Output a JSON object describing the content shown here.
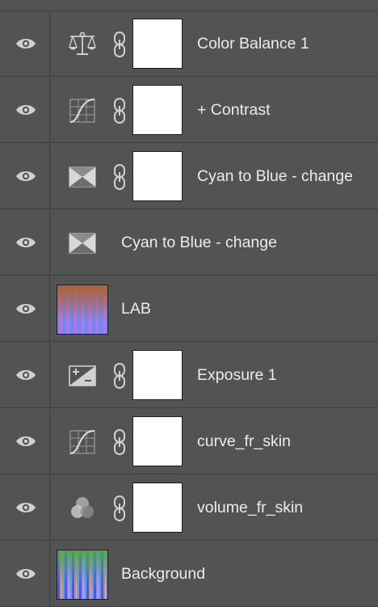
{
  "layers_panel": {
    "layers": [
      {
        "name": "Color Balance 1",
        "kind": "adjustment",
        "icon": "color-balance-icon",
        "has_mask": true,
        "visible": true
      },
      {
        "name": "+ Contrast",
        "kind": "adjustment",
        "icon": "curves-icon",
        "has_mask": true,
        "visible": true
      },
      {
        "name": "Cyan to Blue - change",
        "kind": "adjustment",
        "icon": "channel-mixer-icon",
        "has_mask": true,
        "visible": true
      },
      {
        "name": "Cyan to Blue - change",
        "kind": "adjustment",
        "icon": "channel-mixer-icon",
        "has_mask": false,
        "visible": true
      },
      {
        "name": "LAB",
        "kind": "pixel",
        "icon": "image-thumbnail",
        "has_mask": false,
        "visible": true
      },
      {
        "name": "Exposure 1",
        "kind": "adjustment",
        "icon": "exposure-icon",
        "has_mask": true,
        "visible": true
      },
      {
        "name": "curve_fr_skin",
        "kind": "adjustment",
        "icon": "curves-icon",
        "has_mask": true,
        "visible": true
      },
      {
        "name": "volume_fr_skin",
        "kind": "adjustment",
        "icon": "channel-mixer-circles-icon",
        "has_mask": true,
        "visible": true
      },
      {
        "name": "Background",
        "kind": "pixel",
        "icon": "image-thumbnail",
        "has_mask": false,
        "visible": true
      }
    ],
    "colors": {
      "panel_bg": "#535353",
      "divider": "#3d3d3d",
      "text": "#ececec",
      "icon": "#d0d0d0"
    }
  }
}
